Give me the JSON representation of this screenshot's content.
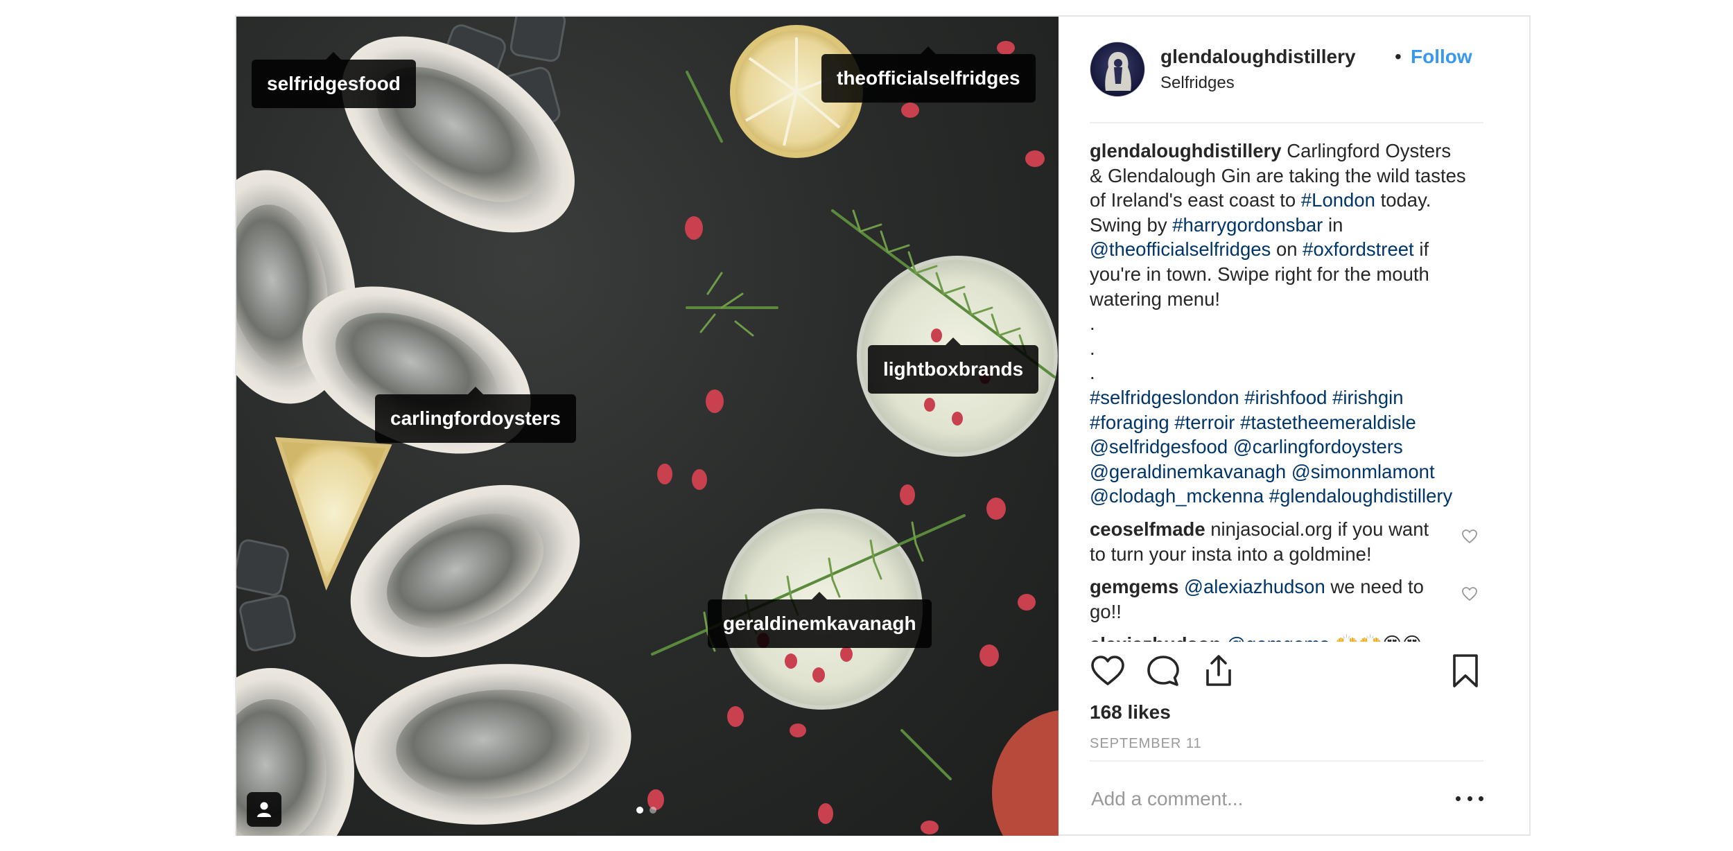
{
  "post": {
    "username": "glendaloughdistillery",
    "bullet": "•",
    "follow_label": "Follow",
    "location": "Selfridges"
  },
  "photo": {
    "tags": [
      {
        "label": "selfridgesfood"
      },
      {
        "label": "theofficialselfridges"
      },
      {
        "label": "lightboxbrands"
      },
      {
        "label": "carlingfordoysters"
      },
      {
        "label": "geraldinemkavanagh"
      }
    ],
    "carousel_dots": 2,
    "active_dot": 1,
    "icons": {
      "next": "chevron-right-icon",
      "tagged_users": "person-icon"
    }
  },
  "caption": {
    "author": "glendaloughdistillery",
    "line1_rest": "Carlingford Oysters",
    "line2": "& Glendalough Gin are taking the wild tastes",
    "line3_pre": "of Ireland's east coast to",
    "line3_link": "#London",
    "line3_post": "today.",
    "line4_pre": "Swing by",
    "line4_link": "#harrygordonsbar",
    "line4_post": "in",
    "line5_link1": "@theofficialselfridges",
    "line5_mid": "on",
    "line5_link2": "#oxfordstreet",
    "line5_post": "if",
    "line6": "you're in town. Swipe right for the mouth",
    "line7": "watering menu!",
    "dot1": ".",
    "dot2": ".",
    "dot3": ".",
    "tags_line1": [
      "#selfridgeslondon",
      "#irishfood",
      "#irishgin"
    ],
    "tags_line2": [
      "#foraging",
      "#terroir",
      "#tastetheemeraldisle"
    ],
    "tags_line3": [
      "@selfridgesfood",
      "@carlingfordoysters"
    ],
    "tags_line4": [
      "@geraldinemkavanagh",
      "@simonmlamont"
    ],
    "tags_line5": [
      "@clodagh_mckenna",
      "#glendaloughdistillery"
    ]
  },
  "comments": [
    {
      "author": "ceoselfmade",
      "text1": "ninjasocial.org if you want",
      "text2": "to turn your insta into a goldmine!"
    },
    {
      "author": "gemgems",
      "link": "@alexiazhudson",
      "text1": "we need to",
      "text2": "go!!"
    },
    {
      "author": "alexiazhudson",
      "link": "@gemgems",
      "text1": "🙌🙌😍😍"
    }
  ],
  "actions": {
    "icons": [
      "heart-icon",
      "comment-icon",
      "share-icon",
      "bookmark-icon"
    ]
  },
  "likes": "168 likes",
  "date": "SEPTEMBER 11",
  "add_comment": {
    "placeholder": "Add a comment..."
  },
  "colors": {
    "link": "#003569",
    "follow": "#3897f0",
    "muted": "#999999",
    "text": "#262626"
  }
}
